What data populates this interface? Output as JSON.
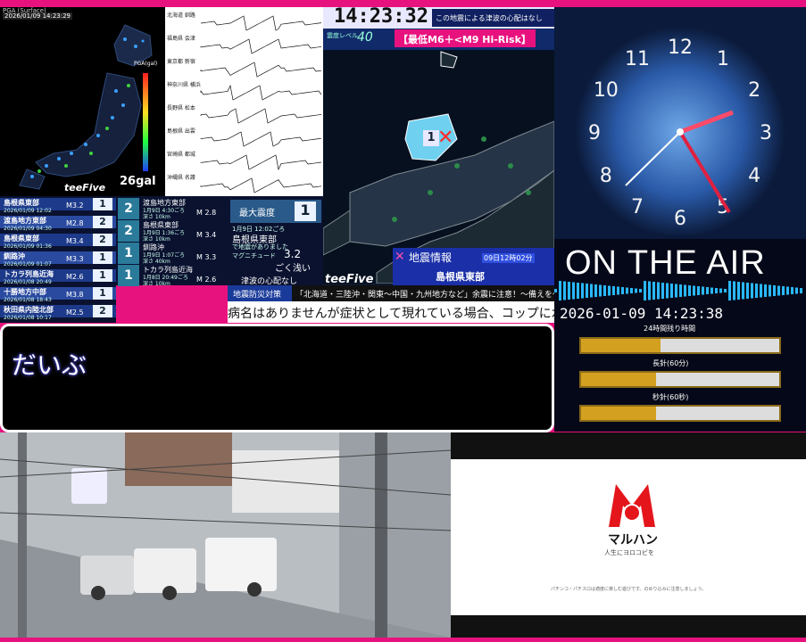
{
  "map": {
    "header": "PGA (Surface)",
    "datetime": "2026/01/09 14:23:29",
    "gal": "26gal",
    "brand": "teeFive",
    "pga_label": "PGA(gal)"
  },
  "waves": {
    "stations": [
      "北海道 釧路",
      "福島県 会津",
      "東京都 新宿",
      "神奈川県 横浜",
      "長野県 松本",
      "島根県 出雲",
      "宮崎県 都城",
      "沖縄県 名護"
    ]
  },
  "eew": {
    "time": "14:23:32",
    "bunker_label": "この地震による津波の心配はなし",
    "level_label": "震度レベル",
    "level_value": "40",
    "risk": "【最低M6＋<M9 Hi-Risk】",
    "brand": "teeFive",
    "info_title": "地震情報",
    "info_time": "09日12時02分",
    "info_region": "島根県東部",
    "epicenter_intensity": "1"
  },
  "quake_list": [
    {
      "name": "島根県東部",
      "date": "2026/01/09 12:02",
      "mag": "M3.2",
      "intensity": "1"
    },
    {
      "name": "渡島地方東部",
      "date": "2026/01/09 04:30",
      "mag": "M2.8",
      "intensity": "2"
    },
    {
      "name": "島根県東部",
      "date": "2026/01/09 01:36",
      "mag": "M3.4",
      "intensity": "2"
    },
    {
      "name": "釧路沖",
      "date": "2026/01/09 01:07",
      "mag": "M3.3",
      "intensity": "1"
    },
    {
      "name": "トカラ列島近海",
      "date": "2026/01/08 20:49",
      "mag": "M2.6",
      "intensity": "1"
    },
    {
      "name": "十勝地方中部",
      "date": "2026/01/08 18:43",
      "mag": "M3.8",
      "intensity": "1"
    },
    {
      "name": "秋田県内陸北部",
      "date": "2026/01/08 10:17",
      "mag": "M2.5",
      "intensity": "2"
    }
  ],
  "details": [
    {
      "intensity_label": "最大震度",
      "intensity": "2",
      "region": "渡島地方東部",
      "date": "1月9日 4:30ごろ",
      "depth": "深さ 10km",
      "mag": "M 2.8"
    },
    {
      "intensity_label": "最大震度",
      "intensity": "2",
      "region": "島根県東部",
      "date": "1月9日 1:36ごろ",
      "depth": "深さ 10km",
      "mag": "M 3.4"
    },
    {
      "intensity_label": "最大震度",
      "intensity": "1",
      "region": "釧路沖",
      "date": "1月9日 1:07ごろ",
      "depth": "深さ 40km",
      "mag": "M 3.3"
    },
    {
      "intensity_label": "最大震度",
      "intensity": "1",
      "region": "トカラ列島近海",
      "date": "1月8日 20:49ごろ",
      "depth": "深さ 10km",
      "mag": "M 2.6"
    }
  ],
  "main_detail": {
    "max_label": "最大震度",
    "max_value": "1",
    "date": "1月9日 12:02ごろ",
    "region": "島根県東部",
    "sub": "で地震がありました",
    "mag_label": "マグニチュード",
    "mag_value": "3.2",
    "depth_text": "ごく浅い",
    "tsunami": "津波の心配なし"
  },
  "ticker": {
    "tag": "地震防災対策",
    "headline": "「北海道・三陸沖・関東〜中国・九州地方など」余震に注意！〜備えを〜",
    "scroll": "病名はありませんが症状として現れている場合、コップに水を入れて机の"
  },
  "message": {
    "text": "だいぶ"
  },
  "clock": {
    "numbers": [
      "12",
      "1",
      "2",
      "3",
      "4",
      "5",
      "6",
      "7",
      "8",
      "9",
      "10",
      "11"
    ]
  },
  "onair": {
    "title": "ON THE AIR",
    "datetime": "2026-01-09 14:23:38",
    "bars": [
      {
        "label": "24時間残り時間",
        "value": 0.4
      },
      {
        "label": "長針(60分)",
        "value": 0.38
      },
      {
        "label": "秒針(60秒)",
        "value": 0.38
      }
    ]
  },
  "ad": {
    "logo_text": "マルハン",
    "tagline": "人生にヨロコビを",
    "fine_print": "パチンコ・パチスロは適度に楽しむ遊びです。のめり込みに注意しましょう。"
  },
  "colors": {
    "accent": "#e8127f",
    "gold": "#d4a020",
    "eew_pink": "#ff4da6"
  }
}
